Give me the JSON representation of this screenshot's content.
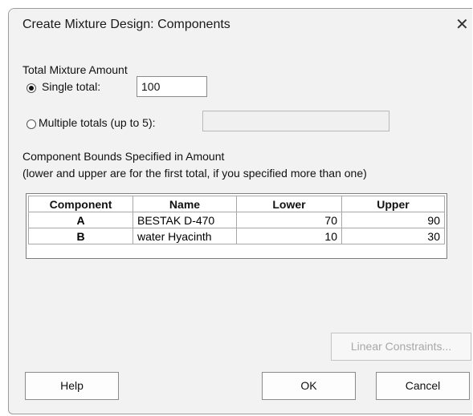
{
  "dialog": {
    "title": "Create Mixture Design: Components",
    "close_symbol": "✕"
  },
  "total_mixture": {
    "heading": "Total Mixture Amount",
    "single_label": "Single total:",
    "single_value": "100",
    "multiple_label": "Multiple totals (up to 5):",
    "multiple_value": "",
    "selected": "single"
  },
  "bounds": {
    "heading": "Component Bounds Specified in Amount",
    "note": "(lower and upper are for the first total, if you specified more than one)"
  },
  "table": {
    "columns": [
      "Component",
      "Name",
      "Lower",
      "Upper"
    ],
    "rows": [
      [
        "A",
        "BESTAK D-470",
        "70",
        "90"
      ],
      [
        "B",
        "water Hyacinth",
        "10",
        "30"
      ]
    ]
  },
  "buttons": {
    "linear_constraints": "Linear Constraints...",
    "help": "Help",
    "ok": "OK",
    "cancel": "Cancel"
  },
  "icons": {
    "close": "close-icon",
    "radio_selected": "radio-selected-icon",
    "radio_unselected": "radio-unselected-icon"
  }
}
